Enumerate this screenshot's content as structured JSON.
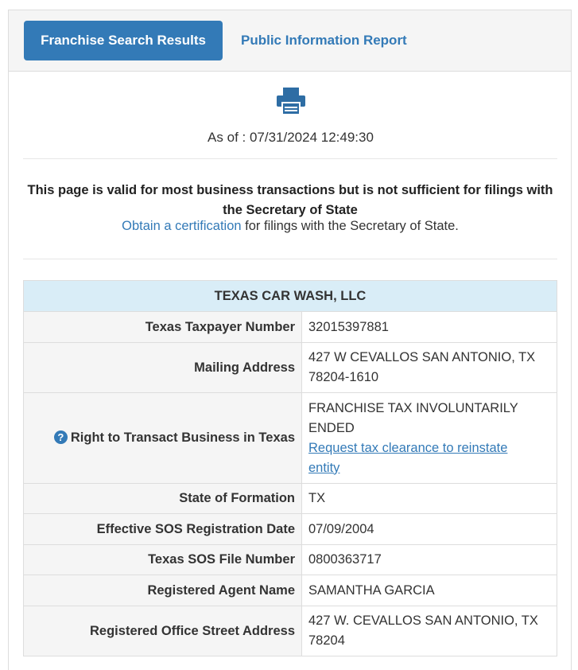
{
  "tabs": {
    "active_label": "Franchise Search Results",
    "other_label": "Public Information Report"
  },
  "icons": {
    "print": "print-icon",
    "help": "question-circle-icon"
  },
  "colors": {
    "primary": "#337ab7",
    "header_bg": "#d9edf7",
    "label_bg": "#f5f5f5"
  },
  "as_of": "As of : 07/31/2024 12:49:30",
  "notice": {
    "bold_text": "This page is valid for most business transactions but is not sufficient for filings with the Secretary of State",
    "link_text": "Obtain a certification",
    "suffix_text": " for filings with the Secretary of State."
  },
  "entity": {
    "name": "TEXAS CAR WASH, LLC",
    "rows": [
      {
        "label": "Texas Taxpayer Number",
        "value": "32015397881"
      },
      {
        "label": "Mailing Address",
        "value_line1": "427 W CEVALLOS SAN ANTONIO, TX",
        "value_line2": "78204-1610"
      },
      {
        "label": "Right to Transact Business in Texas",
        "value_line1": "FRANCHISE TAX INVOLUNTARILY",
        "value_line2": "ENDED",
        "link_line1": "Request tax clearance to reinstate",
        "link_line2": "entity"
      },
      {
        "label": "State of Formation",
        "value": "TX"
      },
      {
        "label": "Effective SOS Registration Date",
        "value": "07/09/2004"
      },
      {
        "label": "Texas SOS File Number",
        "value": "0800363717"
      },
      {
        "label": "Registered Agent Name",
        "value": "SAMANTHA GARCIA"
      },
      {
        "label": "Registered Office Street Address",
        "value_line1": "427 W. CEVALLOS SAN ANTONIO, TX",
        "value_line2": "78204"
      }
    ]
  }
}
